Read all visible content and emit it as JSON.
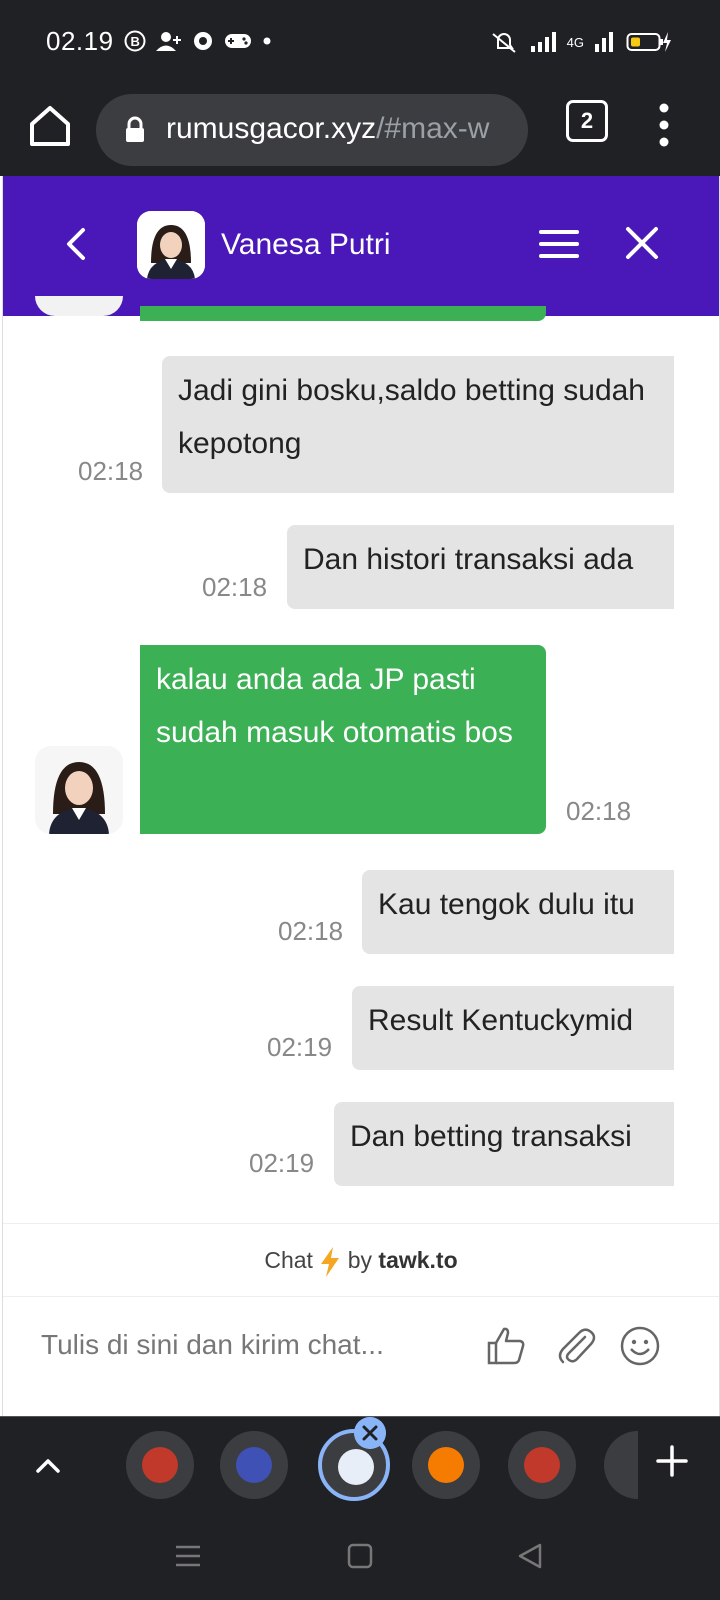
{
  "status_bar": {
    "time": "02.19",
    "network": "4G"
  },
  "browser": {
    "url_host": "rumusgacor.xyz",
    "url_rest": "/#max-w",
    "tab_count": "2"
  },
  "chat": {
    "agent_name": "Vanesa Putri",
    "messages": [
      {
        "side": "out",
        "text": "Jadi gini bosku,saldo betting sudah kepotong",
        "time": "02:18"
      },
      {
        "side": "out",
        "text": "Dan histori transaksi ada",
        "time": "02:18"
      },
      {
        "side": "in",
        "text": "kalau anda ada JP pasti sudah masuk otomatis bos",
        "time": "02:18"
      },
      {
        "side": "out",
        "text": "Kau tengok dulu itu",
        "time": "02:18"
      },
      {
        "side": "out",
        "text": "Result Kentuckymid",
        "time": "02:19"
      },
      {
        "side": "out",
        "text": "Dan betting transaksi",
        "time": "02:19"
      }
    ],
    "branding": {
      "chat": "Chat",
      "by": "by",
      "brand": "tawk.to"
    },
    "composer_placeholder": "Tulis di sini dan kirim chat..."
  },
  "colors": {
    "header": "#4a18b8",
    "agent_bubble": "#3cb054",
    "visitor_bubble": "#e4e4e4",
    "chrome": "#202124"
  },
  "icons": [
    "home-icon",
    "lock-icon",
    "tabs-icon",
    "more-vert-icon",
    "back-icon",
    "hamburger-icon",
    "close-icon",
    "thumbs-up-icon",
    "paperclip-icon",
    "emoji-icon",
    "chevron-up-icon",
    "plus-icon"
  ]
}
